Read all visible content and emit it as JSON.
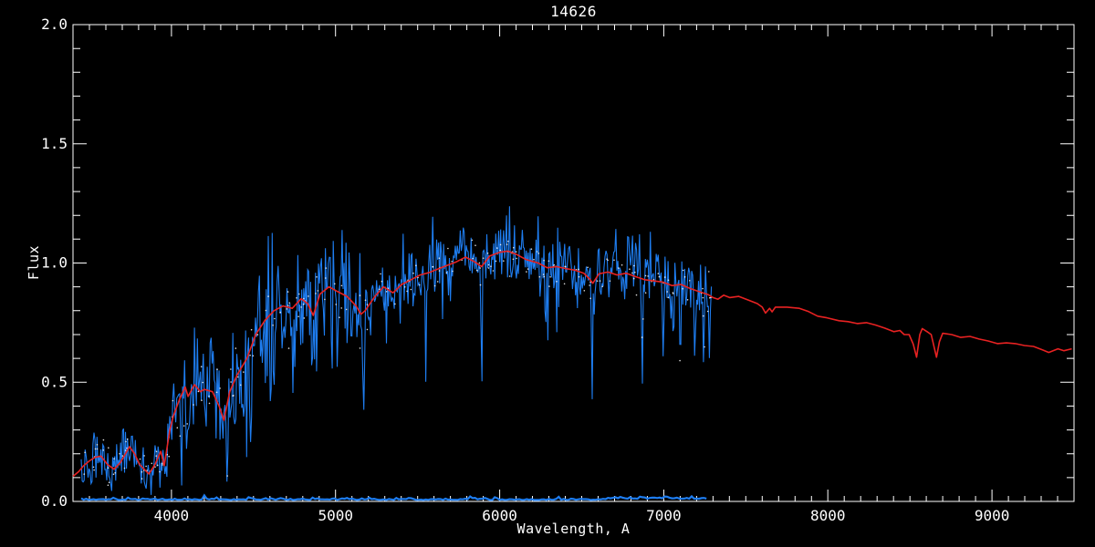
{
  "page": {
    "background": "#000000"
  },
  "chart_data": {
    "type": "line",
    "title": "14626",
    "xlabel": "Wavelength, A",
    "ylabel": "Flux",
    "xlim": [
      3400,
      9500
    ],
    "ylim": [
      0.0,
      2.0
    ],
    "grid": false,
    "legend": "none",
    "x_major_ticks": [
      4000,
      5000,
      6000,
      7000,
      8000,
      9000
    ],
    "x_minor_step": 100,
    "y_major_ticks": [
      0.0,
      0.5,
      1.0,
      1.5,
      2.0
    ],
    "y_minor_step": 0.1,
    "colors": {
      "background": "#000000",
      "axis": "#ffffff",
      "observed": "#1e7df0",
      "model": "#e82222",
      "error": "#1e7df0",
      "specks": "#ffffff"
    },
    "series": [
      {
        "name": "observed-spectrum",
        "role": "noisy-data",
        "color_key": "observed",
        "x_start": 3450,
        "x_end": 7290,
        "sample_step": 6
      },
      {
        "name": "model-fit",
        "role": "model",
        "color_key": "model",
        "points": [
          [
            3400,
            0.105
          ],
          [
            3435,
            0.125
          ],
          [
            3465,
            0.15
          ],
          [
            3500,
            0.17
          ],
          [
            3535,
            0.185
          ],
          [
            3570,
            0.19
          ],
          [
            3610,
            0.155
          ],
          [
            3650,
            0.135
          ],
          [
            3690,
            0.165
          ],
          [
            3745,
            0.23
          ],
          [
            3775,
            0.2
          ],
          [
            3806,
            0.155
          ],
          [
            3862,
            0.115
          ],
          [
            3900,
            0.155
          ],
          [
            3935,
            0.21
          ],
          [
            3956,
            0.15
          ],
          [
            3990,
            0.3
          ],
          [
            4012,
            0.36
          ],
          [
            4050,
            0.43
          ],
          [
            4084,
            0.48
          ],
          [
            4101,
            0.44
          ],
          [
            4140,
            0.49
          ],
          [
            4177,
            0.46
          ],
          [
            4200,
            0.47
          ],
          [
            4250,
            0.46
          ],
          [
            4290,
            0.4
          ],
          [
            4320,
            0.34
          ],
          [
            4355,
            0.46
          ],
          [
            4400,
            0.53
          ],
          [
            4460,
            0.6
          ],
          [
            4513,
            0.7
          ],
          [
            4570,
            0.76
          ],
          [
            4625,
            0.8
          ],
          [
            4680,
            0.82
          ],
          [
            4736,
            0.81
          ],
          [
            4790,
            0.85
          ],
          [
            4830,
            0.83
          ],
          [
            4864,
            0.78
          ],
          [
            4905,
            0.87
          ],
          [
            4960,
            0.9
          ],
          [
            5013,
            0.88
          ],
          [
            5070,
            0.86
          ],
          [
            5125,
            0.82
          ],
          [
            5155,
            0.785
          ],
          [
            5180,
            0.8
          ],
          [
            5240,
            0.86
          ],
          [
            5292,
            0.9
          ],
          [
            5350,
            0.875
          ],
          [
            5403,
            0.91
          ],
          [
            5460,
            0.93
          ],
          [
            5515,
            0.95
          ],
          [
            5570,
            0.96
          ],
          [
            5625,
            0.975
          ],
          [
            5680,
            0.99
          ],
          [
            5736,
            1.005
          ],
          [
            5792,
            1.025
          ],
          [
            5847,
            1.005
          ],
          [
            5890,
            0.985
          ],
          [
            5940,
            1.03
          ],
          [
            6000,
            1.045
          ],
          [
            6050,
            1.05
          ],
          [
            6105,
            1.035
          ],
          [
            6160,
            1.015
          ],
          [
            6235,
            1.0
          ],
          [
            6290,
            0.98
          ],
          [
            6346,
            0.985
          ],
          [
            6400,
            0.977
          ],
          [
            6457,
            0.97
          ],
          [
            6513,
            0.957
          ],
          [
            6545,
            0.935
          ],
          [
            6568,
            0.915
          ],
          [
            6605,
            0.955
          ],
          [
            6660,
            0.962
          ],
          [
            6716,
            0.95
          ],
          [
            6772,
            0.957
          ],
          [
            6827,
            0.943
          ],
          [
            6883,
            0.93
          ],
          [
            6938,
            0.925
          ],
          [
            6994,
            0.92
          ],
          [
            7050,
            0.905
          ],
          [
            7105,
            0.91
          ],
          [
            7161,
            0.893
          ],
          [
            7216,
            0.88
          ],
          [
            7272,
            0.867
          ],
          [
            7300,
            0.855
          ],
          [
            7330,
            0.848
          ],
          [
            7365,
            0.865
          ],
          [
            7402,
            0.855
          ],
          [
            7457,
            0.86
          ],
          [
            7513,
            0.845
          ],
          [
            7570,
            0.83
          ],
          [
            7600,
            0.815
          ],
          [
            7620,
            0.79
          ],
          [
            7645,
            0.81
          ],
          [
            7660,
            0.795
          ],
          [
            7680,
            0.815
          ],
          [
            7752,
            0.815
          ],
          [
            7827,
            0.81
          ],
          [
            7883,
            0.796
          ],
          [
            7938,
            0.777
          ],
          [
            7994,
            0.77
          ],
          [
            8068,
            0.758
          ],
          [
            8124,
            0.754
          ],
          [
            8179,
            0.746
          ],
          [
            8235,
            0.75
          ],
          [
            8290,
            0.74
          ],
          [
            8346,
            0.727
          ],
          [
            8402,
            0.712
          ],
          [
            8439,
            0.717
          ],
          [
            8465,
            0.7
          ],
          [
            8495,
            0.7
          ],
          [
            8520,
            0.66
          ],
          [
            8541,
            0.605
          ],
          [
            8560,
            0.7
          ],
          [
            8575,
            0.725
          ],
          [
            8605,
            0.712
          ],
          [
            8630,
            0.7
          ],
          [
            8662,
            0.605
          ],
          [
            8680,
            0.67
          ],
          [
            8700,
            0.705
          ],
          [
            8755,
            0.7
          ],
          [
            8810,
            0.688
          ],
          [
            8866,
            0.692
          ],
          [
            8921,
            0.681
          ],
          [
            8977,
            0.673
          ],
          [
            9033,
            0.662
          ],
          [
            9088,
            0.665
          ],
          [
            9142,
            0.662
          ],
          [
            9198,
            0.654
          ],
          [
            9253,
            0.65
          ],
          [
            9309,
            0.635
          ],
          [
            9346,
            0.625
          ],
          [
            9402,
            0.64
          ],
          [
            9439,
            0.632
          ],
          [
            9486,
            0.64
          ]
        ]
      },
      {
        "name": "error-spectrum",
        "role": "error",
        "color_key": "error",
        "x_start": 3450,
        "x_end": 7265,
        "base_flux": 0.006,
        "sample_step": 15
      }
    ],
    "absorption_lines": [
      {
        "center": 3933,
        "depth": 0.45,
        "sigma": 8
      },
      {
        "center": 3968,
        "depth": 0.4,
        "sigma": 7
      },
      {
        "center": 4101,
        "depth": 0.5,
        "sigma": 7
      },
      {
        "center": 4227,
        "depth": 0.3,
        "sigma": 5
      },
      {
        "center": 4340,
        "depth": 0.68,
        "sigma": 7
      },
      {
        "center": 4430,
        "depth": 0.28,
        "sigma": 6
      },
      {
        "center": 4540,
        "depth": 0.2,
        "sigma": 6
      },
      {
        "center": 4861,
        "depth": 0.42,
        "sigma": 6
      },
      {
        "center": 5172,
        "depth": 0.55,
        "sigma": 7
      },
      {
        "center": 5890,
        "depth": 0.48,
        "sigma": 5
      },
      {
        "center": 6280,
        "depth": 0.2,
        "sigma": 5
      },
      {
        "center": 6563,
        "depth": 0.55,
        "sigma": 5
      },
      {
        "center": 6870,
        "depth": 0.33,
        "sigma": 6
      },
      {
        "center": 7100,
        "depth": 0.36,
        "sigma": 5
      },
      {
        "center": 7185,
        "depth": 0.3,
        "sigma": 6
      },
      {
        "center": 7245,
        "depth": 0.3,
        "sigma": 5
      }
    ],
    "noise_profile": [
      {
        "upto": 3900,
        "sigma": 0.42
      },
      {
        "upto": 4150,
        "sigma": 0.3
      },
      {
        "upto": 4650,
        "sigma": 0.25
      },
      {
        "upto": 5250,
        "sigma": 0.13
      },
      {
        "upto": 6250,
        "sigma": 0.065
      },
      {
        "upto": 6700,
        "sigma": 0.075
      },
      {
        "upto": 7400,
        "sigma": 0.09
      }
    ],
    "spike_probability": 0.055,
    "speck_count": 240,
    "seed": 1337
  }
}
